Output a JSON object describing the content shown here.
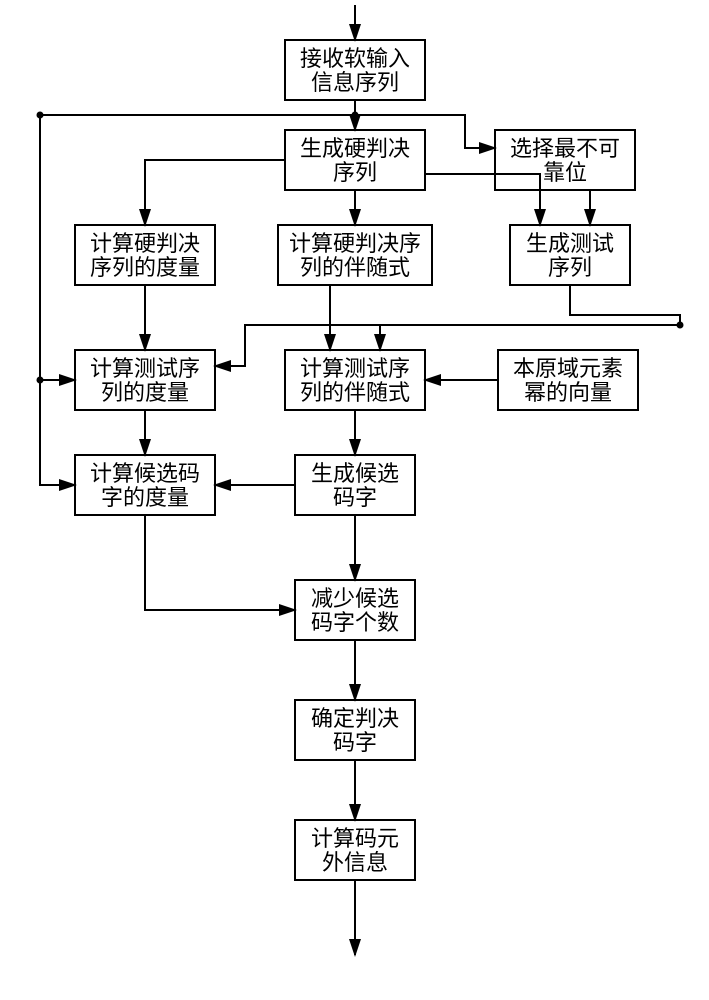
{
  "chart_data": {
    "type": "flowchart",
    "nodes": [
      {
        "id": "n1",
        "lines": [
          "接收软输入",
          "信息序列"
        ]
      },
      {
        "id": "n2",
        "lines": [
          "生成硬判决",
          "序列"
        ]
      },
      {
        "id": "n3",
        "lines": [
          "选择最不可",
          "靠位"
        ]
      },
      {
        "id": "n4",
        "lines": [
          "计算硬判决",
          "序列的度量"
        ]
      },
      {
        "id": "n5",
        "lines": [
          "计算硬判决序",
          "列的伴随式"
        ]
      },
      {
        "id": "n6",
        "lines": [
          "生成测试",
          "序列"
        ]
      },
      {
        "id": "n7",
        "lines": [
          "计算测试序",
          "列的度量"
        ]
      },
      {
        "id": "n8",
        "lines": [
          "计算测试序",
          "列的伴随式"
        ]
      },
      {
        "id": "n9",
        "lines": [
          "本原域元素",
          "幂的向量"
        ]
      },
      {
        "id": "n10",
        "lines": [
          "计算候选码",
          "字的度量"
        ]
      },
      {
        "id": "n11",
        "lines": [
          "生成候选",
          "码字"
        ]
      },
      {
        "id": "n12",
        "lines": [
          "减少候选",
          "码字个数"
        ]
      },
      {
        "id": "n13",
        "lines": [
          "确定判决",
          "码字"
        ]
      },
      {
        "id": "n14",
        "lines": [
          "计算码元",
          "外信息"
        ]
      }
    ],
    "edges": [
      {
        "from": "start",
        "to": "n1"
      },
      {
        "from": "n1",
        "to": "n2"
      },
      {
        "from": "n2",
        "to": "n3"
      },
      {
        "from": "n2",
        "to": "n5"
      },
      {
        "from": "n2",
        "to": "n6"
      },
      {
        "from": "n3",
        "to": "n6"
      },
      {
        "from": "n1",
        "to": "n4"
      },
      {
        "from": "n1",
        "to": "n7"
      },
      {
        "from": "n1",
        "to": "n10"
      },
      {
        "from": "n4",
        "to": "n7"
      },
      {
        "from": "n5",
        "to": "n8"
      },
      {
        "from": "n6",
        "to": "n7"
      },
      {
        "from": "n6",
        "to": "n8"
      },
      {
        "from": "n9",
        "to": "n8"
      },
      {
        "from": "n7",
        "to": "n10"
      },
      {
        "from": "n8",
        "to": "n11"
      },
      {
        "from": "n11",
        "to": "n10"
      },
      {
        "from": "n11",
        "to": "n12"
      },
      {
        "from": "n10",
        "to": "n12"
      },
      {
        "from": "n12",
        "to": "n13"
      },
      {
        "from": "n13",
        "to": "n14"
      },
      {
        "from": "n14",
        "to": "end"
      }
    ]
  }
}
